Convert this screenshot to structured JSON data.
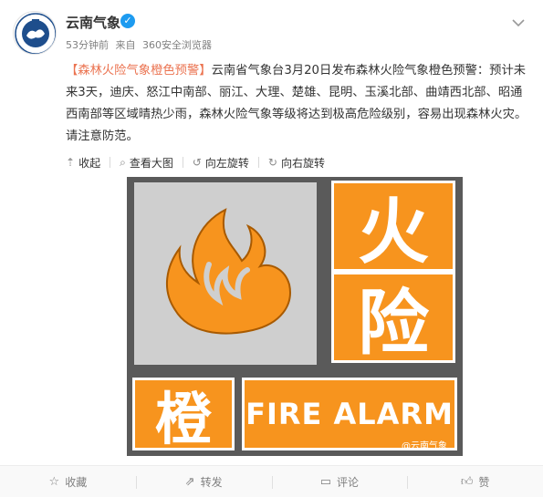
{
  "post": {
    "author": "云南气象",
    "time": "53分钟前",
    "source_prefix": "来自",
    "source": "360安全浏览器",
    "text_tag": "【森林火险气象橙色预警】",
    "text_body": "云南省气象台3月20日发布森林火险气象橙色预警：预计未来3天，迪庆、怒江中南部、丽江、大理、楚雄、昆明、玉溪北部、曲靖西北部、昭通西南部等区域晴热少雨，森林火险气象等级将达到极高危险级别，容易出现森林火灾。请注意防范。"
  },
  "toolbar": {
    "collapse": "收起",
    "view_large": "查看大图",
    "rotate_left": "向左旋转",
    "rotate_right": "向右旋转"
  },
  "image": {
    "char_huo": "火",
    "char_xian": "险",
    "char_cheng": "橙",
    "en_label": "FIRE  ALARM",
    "watermark": "@云南气象",
    "color_orange": "#f7941e",
    "color_grey": "#cfcfcf"
  },
  "actions": {
    "favorite": "收藏",
    "repost": "转发",
    "comment": "评论",
    "like": "赞"
  },
  "colors": {
    "accent": "#eb7350",
    "verified": "#1d9bf0"
  }
}
